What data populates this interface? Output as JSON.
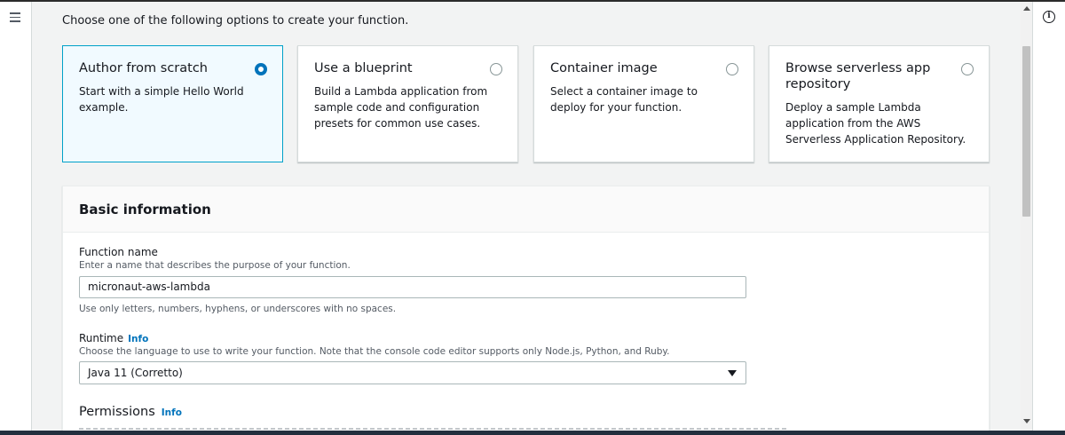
{
  "intro": "Choose one of the following options to create your function.",
  "options": [
    {
      "title": "Author from scratch",
      "desc": "Start with a simple Hello World example.",
      "selected": true
    },
    {
      "title": "Use a blueprint",
      "desc": "Build a Lambda application from sample code and configuration presets for common use cases.",
      "selected": false
    },
    {
      "title": "Container image",
      "desc": "Select a container image to deploy for your function.",
      "selected": false
    },
    {
      "title": "Browse serverless app repository",
      "desc": "Deploy a sample Lambda application from the AWS Serverless Application Repository.",
      "selected": false
    }
  ],
  "basic_info": {
    "title": "Basic information",
    "function_name": {
      "label": "Function name",
      "hint": "Enter a name that describes the purpose of your function.",
      "value": "micronaut-aws-lambda",
      "constraint": "Use only letters, numbers, hyphens, or underscores with no spaces."
    },
    "runtime": {
      "label": "Runtime",
      "info": "Info",
      "hint": "Choose the language to use to write your function. Note that the console code editor supports only Node.js, Python, and Ruby.",
      "value": "Java 11 (Corretto)"
    },
    "permissions": {
      "label": "Permissions",
      "info": "Info"
    }
  },
  "icons": {
    "menu": "hamburger-menu-icon",
    "info": "info-circle-icon",
    "dropdown": "caret-down-icon"
  },
  "colors": {
    "selected_border": "#00a1c9",
    "selected_bg": "#f1faff",
    "radio_on": "#0073bb",
    "link": "#0073bb"
  }
}
